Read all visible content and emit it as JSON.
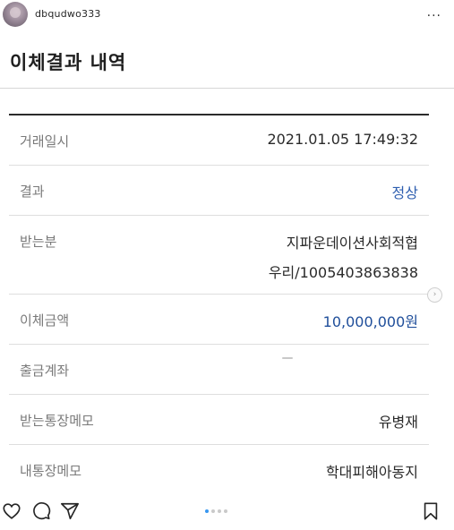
{
  "header": {
    "username": "dbqudwo333",
    "more_label": "..."
  },
  "post": {
    "title": "이체결과 내역",
    "rows": [
      {
        "label": "거래일시",
        "value": "2021.01.05 17:49:32"
      },
      {
        "label": "결과",
        "value": "정상"
      },
      {
        "label": "받는분",
        "value_line1": "지파운데이션사회적협",
        "value_line2": "우리/1005403863838"
      },
      {
        "label": "이체금액",
        "value": "10,000,000원"
      },
      {
        "label": "출금계좌",
        "value": ""
      },
      {
        "label": "받는통장메모",
        "value": "유병재"
      },
      {
        "label": "내통장메모",
        "value": "학대피해아동지"
      }
    ]
  },
  "carousel": {
    "page_count": 4,
    "active_index": 0
  },
  "colors": {
    "accent_blue": "#2f5fb0",
    "carousel_active": "#3897f0"
  },
  "icons": [
    "heart-icon",
    "comment-icon",
    "share-icon",
    "bookmark-icon",
    "more-icon",
    "next-arrow-icon"
  ]
}
